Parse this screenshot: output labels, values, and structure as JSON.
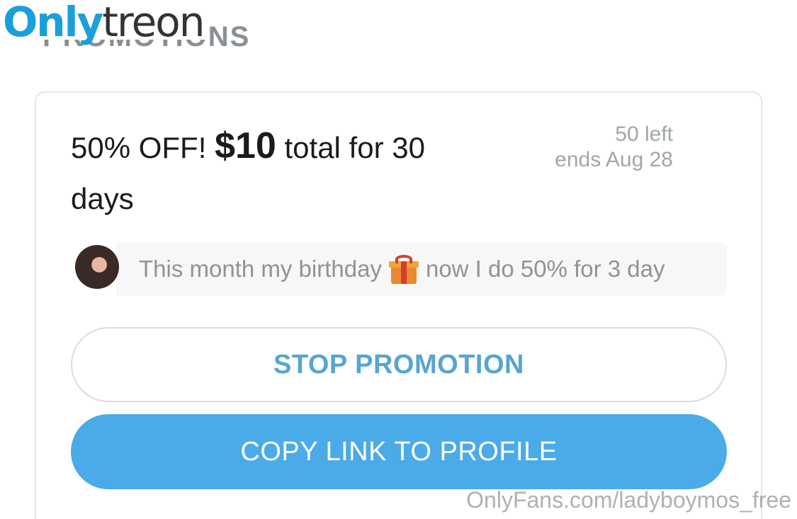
{
  "watermark": {
    "logo_part1": "Only",
    "logo_part2": "treon",
    "url": "OnlyFans.com/ladyboymos_free"
  },
  "section": {
    "heading": "PROMOTIONS"
  },
  "promotion": {
    "title_prefix": "50% OFF! ",
    "price": "$10",
    "title_suffix": " total for 30 days",
    "remaining": "50 left",
    "ends": "ends Aug 28",
    "message_part1": "This month my birthday",
    "message_part2": "now I do 50% for 3 day",
    "message_icon": "gift-icon"
  },
  "buttons": {
    "stop_label": "STOP PROMOTION",
    "copy_label": "COPY LINK TO PROFILE"
  },
  "colors": {
    "accent": "#4aabe8",
    "stop_text": "#57a5d2",
    "logo_blue": "#1a9fd9"
  }
}
